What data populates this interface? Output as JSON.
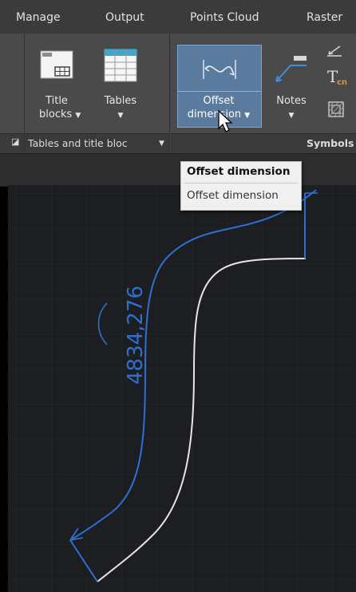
{
  "menu": {
    "tabs": [
      "Manage",
      "Output",
      "Points Cloud",
      "Raster"
    ]
  },
  "ribbon": {
    "tables_panel": {
      "title_blocks_line1": "Title",
      "title_blocks_line2": "blocks",
      "tables_label": "Tables",
      "footer": "Tables and title bloc"
    },
    "symbols_panel": {
      "offset_line1": "Offset",
      "offset_line2": "dimension",
      "notes_label": "Notes",
      "tcn_glyph": "T",
      "tcn_sub": "cn",
      "footer": "Symbols"
    }
  },
  "tooltip": {
    "title": "Offset dimension",
    "description": "Offset dimension"
  },
  "drawing": {
    "dimension_text": "4834,276"
  },
  "colors": {
    "accent_blue": "#2f6fd0",
    "curve_white": "#e6e6e6",
    "selected_button": "#5a7a9e"
  }
}
